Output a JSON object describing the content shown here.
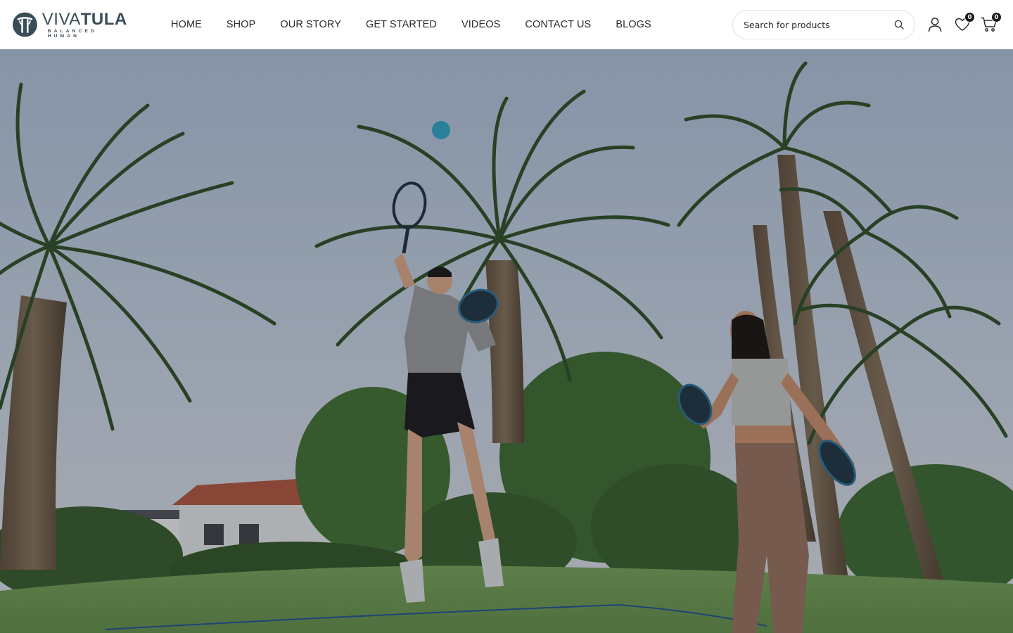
{
  "brand": {
    "name_light": "VIVA",
    "name_bold": "TULA",
    "tagline": "BALANCED HUMAN",
    "logo_icon": "tula-mark-icon",
    "color": "#3a4c57"
  },
  "nav": {
    "items": [
      {
        "label": "HOME"
      },
      {
        "label": "SHOP"
      },
      {
        "label": "OUR STORY"
      },
      {
        "label": "GET STARTED"
      },
      {
        "label": "VIDEOS"
      },
      {
        "label": "CONTACT US"
      },
      {
        "label": "BLOGS"
      }
    ]
  },
  "search": {
    "placeholder": "Search for products",
    "value": "",
    "icon": "search-icon"
  },
  "actions": {
    "account_icon": "user-icon",
    "wishlist_icon": "heart-icon",
    "wishlist_count": "0",
    "cart_icon": "cart-icon",
    "cart_count": "0"
  },
  "hero": {
    "image": "two players jumping with paddle rackets and a blue ball under palm trees on a lawn",
    "ball_color": "#2f97b8",
    "sky_color": "#a9b6c8",
    "grass_color": "#6f9a55"
  }
}
